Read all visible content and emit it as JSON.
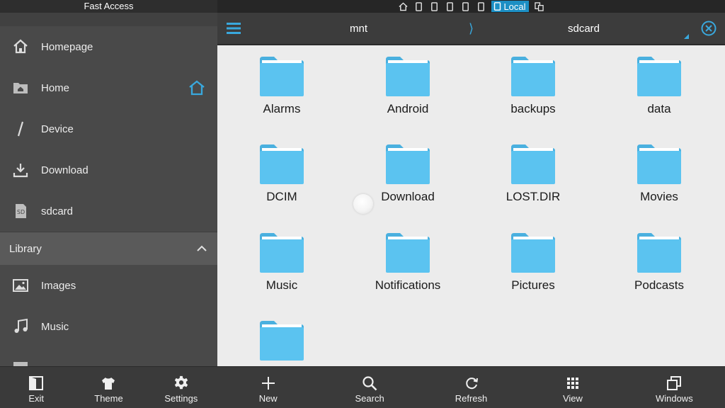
{
  "drawer": {
    "title": "Fast Access",
    "items": [
      {
        "label": "Homepage",
        "icon": "house-icon"
      },
      {
        "label": "Home",
        "icon": "home-folder-icon"
      },
      {
        "label": "Device",
        "icon": "slash-icon"
      },
      {
        "label": "Download",
        "icon": "download-icon"
      },
      {
        "label": "sdcard",
        "icon": "sd-card-icon",
        "icon_text": "SD"
      }
    ],
    "library": {
      "label": "Library",
      "items": [
        {
          "label": "Images",
          "icon": "image-icon"
        },
        {
          "label": "Music",
          "icon": "music-note-icon"
        }
      ]
    },
    "bottom": [
      {
        "label": "Exit",
        "icon": "exit-icon"
      },
      {
        "label": "Theme",
        "icon": "tshirt-icon"
      },
      {
        "label": "Settings",
        "icon": "gear-icon"
      }
    ]
  },
  "status": {
    "local_label": "Local"
  },
  "toolbar": {
    "crumbs": [
      "mnt",
      "sdcard"
    ],
    "separator": "⟩"
  },
  "folders": [
    "Alarms",
    "Android",
    "backups",
    "data",
    "DCIM",
    "Download",
    "LOST.DIR",
    "Movies",
    "Music",
    "Notifications",
    "Pictures",
    "Podcasts",
    ""
  ],
  "bottom": [
    {
      "label": "New",
      "icon": "plus-icon"
    },
    {
      "label": "Search",
      "icon": "search-icon"
    },
    {
      "label": "Refresh",
      "icon": "refresh-icon"
    },
    {
      "label": "View",
      "icon": "grid-icon"
    },
    {
      "label": "Windows",
      "icon": "windows-icon"
    }
  ],
  "colors": {
    "accent": "#39a8dd",
    "folder": "#5bc3f0",
    "folder_tab": "#4ab0df"
  }
}
